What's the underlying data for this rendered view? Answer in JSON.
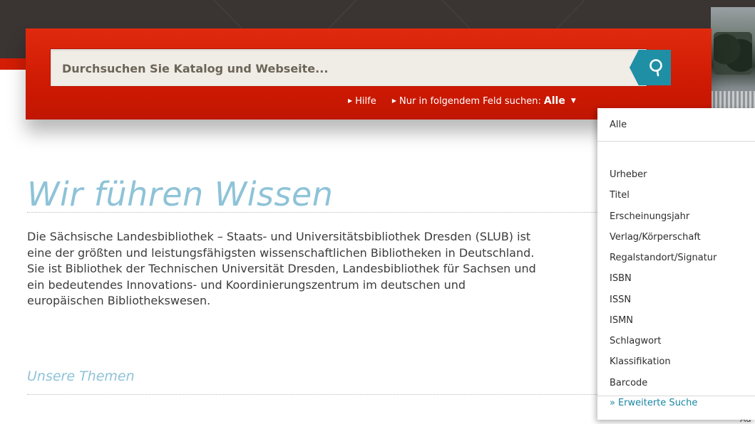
{
  "colors": {
    "brand_red": "#d51c04",
    "dark_band": "#3a3433",
    "accent_blue": "#8ec3d8",
    "search_button": "#1f8fa6",
    "link_teal": "#1a86a3"
  },
  "search": {
    "placeholder": "Durchsuchen Sie Katalog und Webseite...",
    "value": "",
    "button_icon": "search-icon",
    "help_label": "Hilfe",
    "field_label": "Nur in folgendem Feld suchen:",
    "field_value": "Alle",
    "arrow_icon": "arrow-right-icon",
    "caret_icon": "caret-down-icon"
  },
  "content": {
    "headline": "Wir führen Wissen",
    "paragraph_lines": [
      "Die Sächsische Landesbibliothek – Staats- und Universitätsbibliothek Dresden (SLUB) ist",
      "eine der größten und leistungsfähigsten wissenschaftlichen Bibliotheken in Deutschland.",
      "Sie ist Bibliothek der Technischen Universität Dresden, Landesbibliothek für Sachsen und",
      "ein bedeutendes Innovations- und Koordinierungszentrum im deutschen und",
      "europäischen Bibliothekswesen."
    ],
    "subheading": "Unsere Themen"
  },
  "dropdown": {
    "items": [
      "Alle",
      "Urheber",
      "Titel",
      "Erscheinungsjahr",
      "Verlag/Körperschaft",
      "Regalstandort/Signatur",
      "ISBN",
      "ISSN",
      "ISMN",
      "Schlagwort",
      "Klassifikation",
      "Barcode"
    ],
    "advanced_search": "Erweiterte Suche",
    "advanced_prefix": "»"
  },
  "partial_text_behind_dropdown": "Ad"
}
